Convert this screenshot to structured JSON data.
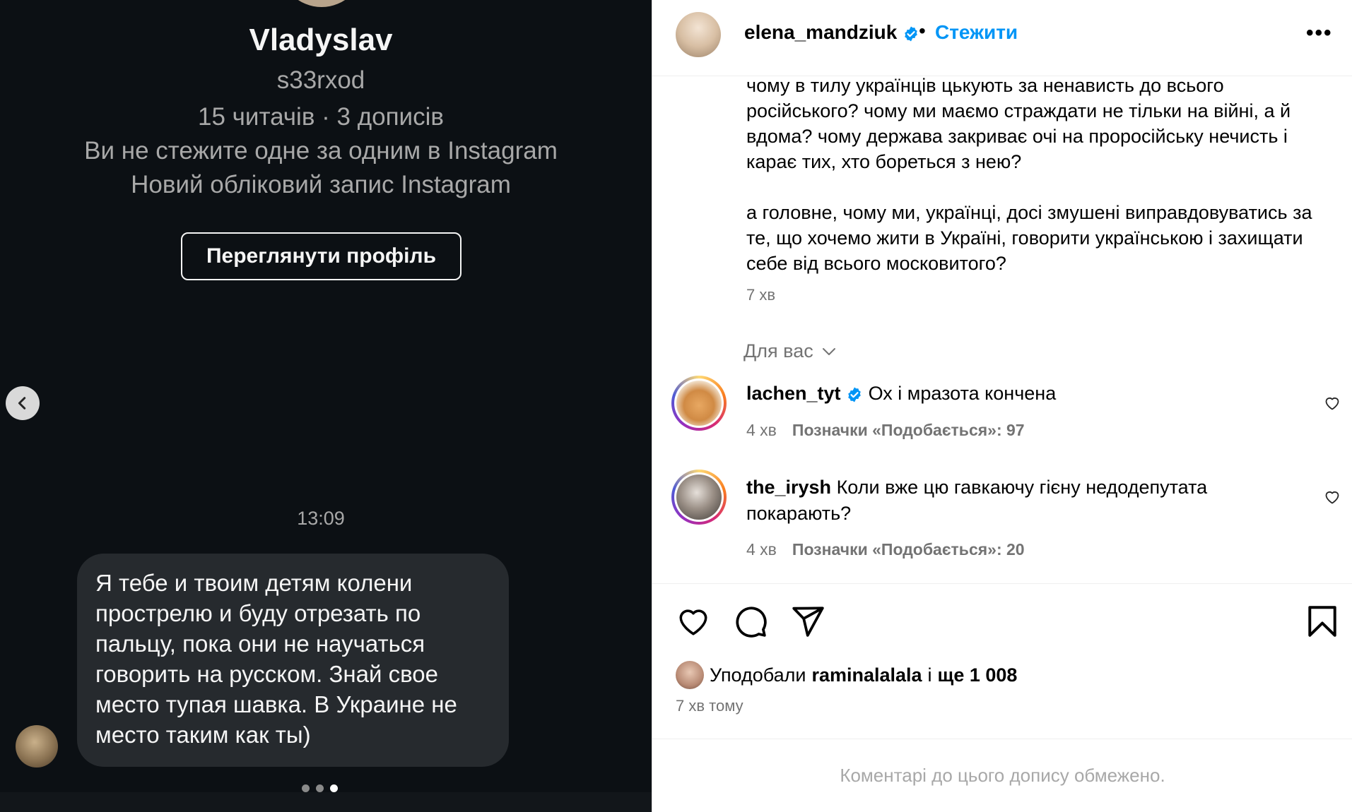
{
  "dm": {
    "name": "Vladyslav",
    "handle": "s33rxod",
    "stats": "15 читачів · 3 дописів",
    "follow_status": "Ви не стежите одне за одним в Instagram",
    "account_note": "Новий обліковий запис Instagram",
    "view_profile_label": "Переглянути профіль",
    "time": "13:09",
    "message": "Я тебе и твоим детям колени прострелю и буду отрезать по пальцу, пока они не научаться говорить на русском. Знай свое место тупая шавка. В Украине не место таким как ты)",
    "carousel_dots": 3,
    "carousel_active": 3
  },
  "post": {
    "username": "elena_mandziuk",
    "separator": "•",
    "follow_label": "Стежити",
    "more_label": "•••",
    "caption_paragraphs": [
      "чому в тилу українців цькують за ненависть до всього російського? чому ми маємо страждати не тільки на війні, а й вдома? чому держава закриває очі на проросійську нечисть і карає тих, хто бореться з нею?",
      "а головне, чому ми, українці, досі змушені виправдовуватись за те, що хочемо жити в Україні, говорити українською і захищати себе від всього московитого?"
    ],
    "caption_time": "7 хв",
    "filter_label": "Для вас",
    "comments": [
      {
        "username": "lachen_tyt",
        "verified": true,
        "text": "Ох і мразота кончена",
        "time": "4 хв",
        "likes": "Позначки «Подобається»: 97"
      },
      {
        "username": "the_irysh",
        "verified": false,
        "text": "Коли вже цю гавкаючу гієну недодепутата покарають?",
        "time": "4 хв",
        "likes": "Позначки «Подобається»: 20"
      }
    ],
    "liked_by_prefix": "Уподобали",
    "liked_by_user": "raminalalala",
    "liked_by_joiner": "і",
    "liked_by_rest": "ще 1 008",
    "post_time": "7 хв тому",
    "restricted_note": "Коментарі до цього допису обмежено."
  },
  "colors": {
    "dark_bg": "#0c1014",
    "bubble": "#262a2e",
    "link_blue": "#0095f6",
    "verified_blue": "#0095f6",
    "muted": "#737373"
  },
  "icons": [
    "chevron-left-icon",
    "verified-badge-icon",
    "more-icon",
    "chevron-down-icon",
    "heart-icon",
    "comment-icon",
    "share-icon",
    "bookmark-icon"
  ]
}
